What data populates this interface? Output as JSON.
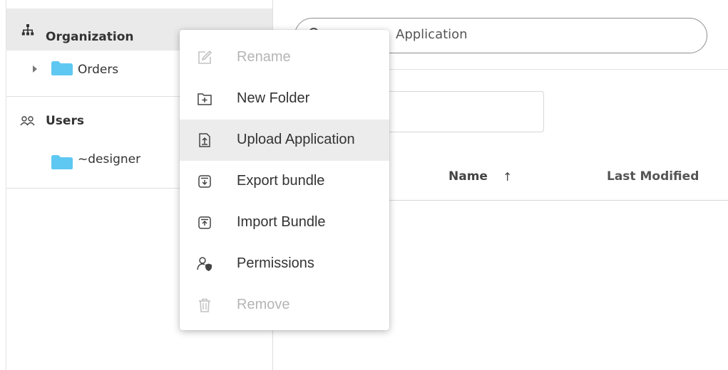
{
  "sidebar": {
    "header": {
      "label": "Organization"
    },
    "tree": [
      {
        "label": "Orders"
      }
    ],
    "users": {
      "label": "Users",
      "items": [
        {
          "label": "~designer"
        }
      ]
    }
  },
  "search": {
    "text": "Application"
  },
  "table": {
    "columns": [
      {
        "label": "Name"
      },
      {
        "label": "Last Modified"
      }
    ],
    "sort_indicator": "↑"
  },
  "context_menu": {
    "items": [
      {
        "label": "Rename",
        "icon": "rename-icon",
        "state": "disabled"
      },
      {
        "label": "New Folder",
        "icon": "new-folder-icon",
        "state": "enabled"
      },
      {
        "label": "Upload Application",
        "icon": "upload-application-icon",
        "state": "hovered"
      },
      {
        "label": "Export bundle",
        "icon": "export-bundle-icon",
        "state": "enabled"
      },
      {
        "label": "Import Bundle",
        "icon": "import-bundle-icon",
        "state": "enabled"
      },
      {
        "label": "Permissions",
        "icon": "permissions-icon",
        "state": "enabled"
      },
      {
        "label": "Remove",
        "icon": "trash-icon",
        "state": "disabled"
      }
    ]
  },
  "colors": {
    "folder": "#5ec8f2",
    "menu_hover": "#ececec",
    "disabled_text": "#b5b5b5"
  }
}
